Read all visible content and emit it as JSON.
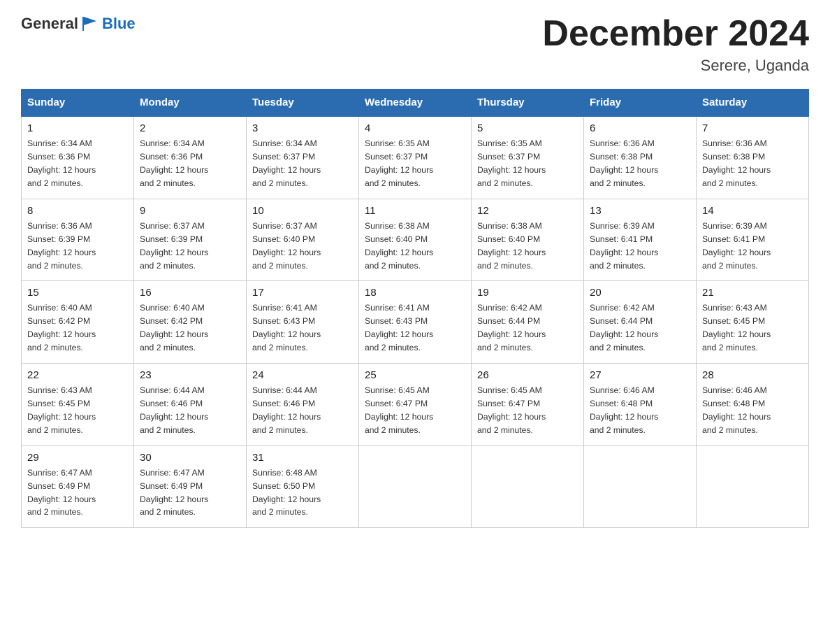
{
  "header": {
    "logo": {
      "text_general": "General",
      "text_blue": "Blue",
      "icon_alt": "GeneralBlue logo flag"
    },
    "month_title": "December 2024",
    "location": "Serere, Uganda"
  },
  "calendar": {
    "headers": [
      "Sunday",
      "Monday",
      "Tuesday",
      "Wednesday",
      "Thursday",
      "Friday",
      "Saturday"
    ],
    "weeks": [
      [
        {
          "day": "1",
          "sunrise": "6:34 AM",
          "sunset": "6:36 PM",
          "daylight": "12 hours and 2 minutes."
        },
        {
          "day": "2",
          "sunrise": "6:34 AM",
          "sunset": "6:36 PM",
          "daylight": "12 hours and 2 minutes."
        },
        {
          "day": "3",
          "sunrise": "6:34 AM",
          "sunset": "6:37 PM",
          "daylight": "12 hours and 2 minutes."
        },
        {
          "day": "4",
          "sunrise": "6:35 AM",
          "sunset": "6:37 PM",
          "daylight": "12 hours and 2 minutes."
        },
        {
          "day": "5",
          "sunrise": "6:35 AM",
          "sunset": "6:37 PM",
          "daylight": "12 hours and 2 minutes."
        },
        {
          "day": "6",
          "sunrise": "6:36 AM",
          "sunset": "6:38 PM",
          "daylight": "12 hours and 2 minutes."
        },
        {
          "day": "7",
          "sunrise": "6:36 AM",
          "sunset": "6:38 PM",
          "daylight": "12 hours and 2 minutes."
        }
      ],
      [
        {
          "day": "8",
          "sunrise": "6:36 AM",
          "sunset": "6:39 PM",
          "daylight": "12 hours and 2 minutes."
        },
        {
          "day": "9",
          "sunrise": "6:37 AM",
          "sunset": "6:39 PM",
          "daylight": "12 hours and 2 minutes."
        },
        {
          "day": "10",
          "sunrise": "6:37 AM",
          "sunset": "6:40 PM",
          "daylight": "12 hours and 2 minutes."
        },
        {
          "day": "11",
          "sunrise": "6:38 AM",
          "sunset": "6:40 PM",
          "daylight": "12 hours and 2 minutes."
        },
        {
          "day": "12",
          "sunrise": "6:38 AM",
          "sunset": "6:40 PM",
          "daylight": "12 hours and 2 minutes."
        },
        {
          "day": "13",
          "sunrise": "6:39 AM",
          "sunset": "6:41 PM",
          "daylight": "12 hours and 2 minutes."
        },
        {
          "day": "14",
          "sunrise": "6:39 AM",
          "sunset": "6:41 PM",
          "daylight": "12 hours and 2 minutes."
        }
      ],
      [
        {
          "day": "15",
          "sunrise": "6:40 AM",
          "sunset": "6:42 PM",
          "daylight": "12 hours and 2 minutes."
        },
        {
          "day": "16",
          "sunrise": "6:40 AM",
          "sunset": "6:42 PM",
          "daylight": "12 hours and 2 minutes."
        },
        {
          "day": "17",
          "sunrise": "6:41 AM",
          "sunset": "6:43 PM",
          "daylight": "12 hours and 2 minutes."
        },
        {
          "day": "18",
          "sunrise": "6:41 AM",
          "sunset": "6:43 PM",
          "daylight": "12 hours and 2 minutes."
        },
        {
          "day": "19",
          "sunrise": "6:42 AM",
          "sunset": "6:44 PM",
          "daylight": "12 hours and 2 minutes."
        },
        {
          "day": "20",
          "sunrise": "6:42 AM",
          "sunset": "6:44 PM",
          "daylight": "12 hours and 2 minutes."
        },
        {
          "day": "21",
          "sunrise": "6:43 AM",
          "sunset": "6:45 PM",
          "daylight": "12 hours and 2 minutes."
        }
      ],
      [
        {
          "day": "22",
          "sunrise": "6:43 AM",
          "sunset": "6:45 PM",
          "daylight": "12 hours and 2 minutes."
        },
        {
          "day": "23",
          "sunrise": "6:44 AM",
          "sunset": "6:46 PM",
          "daylight": "12 hours and 2 minutes."
        },
        {
          "day": "24",
          "sunrise": "6:44 AM",
          "sunset": "6:46 PM",
          "daylight": "12 hours and 2 minutes."
        },
        {
          "day": "25",
          "sunrise": "6:45 AM",
          "sunset": "6:47 PM",
          "daylight": "12 hours and 2 minutes."
        },
        {
          "day": "26",
          "sunrise": "6:45 AM",
          "sunset": "6:47 PM",
          "daylight": "12 hours and 2 minutes."
        },
        {
          "day": "27",
          "sunrise": "6:46 AM",
          "sunset": "6:48 PM",
          "daylight": "12 hours and 2 minutes."
        },
        {
          "day": "28",
          "sunrise": "6:46 AM",
          "sunset": "6:48 PM",
          "daylight": "12 hours and 2 minutes."
        }
      ],
      [
        {
          "day": "29",
          "sunrise": "6:47 AM",
          "sunset": "6:49 PM",
          "daylight": "12 hours and 2 minutes."
        },
        {
          "day": "30",
          "sunrise": "6:47 AM",
          "sunset": "6:49 PM",
          "daylight": "12 hours and 2 minutes."
        },
        {
          "day": "31",
          "sunrise": "6:48 AM",
          "sunset": "6:50 PM",
          "daylight": "12 hours and 2 minutes."
        },
        null,
        null,
        null,
        null
      ]
    ],
    "labels": {
      "sunrise": "Sunrise:",
      "sunset": "Sunset:",
      "daylight": "Daylight:"
    }
  }
}
